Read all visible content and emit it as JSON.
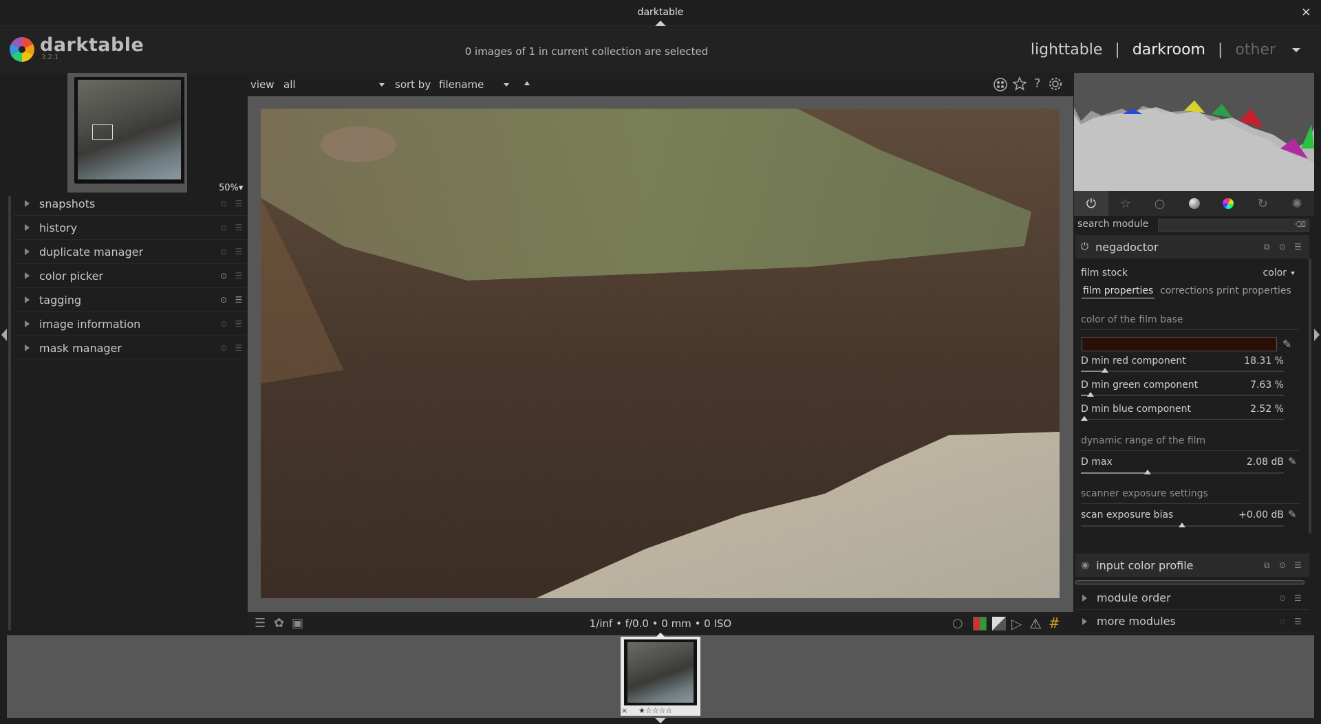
{
  "window": {
    "title": "darktable",
    "close": "×"
  },
  "header": {
    "app_name": "darktable",
    "version": "3.2.1",
    "selection_text": "0 images of 1 in current collection are selected",
    "views": {
      "lighttable": "lighttable",
      "darkroom": "darkroom",
      "other": "other",
      "sep": "|"
    }
  },
  "left": {
    "zoom": "50%▾",
    "modules": [
      {
        "label": "snapshots"
      },
      {
        "label": "history"
      },
      {
        "label": "duplicate manager"
      },
      {
        "label": "color picker"
      },
      {
        "label": "tagging"
      },
      {
        "label": "image information"
      },
      {
        "label": "mask manager"
      }
    ]
  },
  "topbar": {
    "view_label": "view",
    "view_value": "all",
    "sort_label": "sort by",
    "sort_value": "filename"
  },
  "bottombar": {
    "exif": "1/inf • f/0.0 • 0 mm • 0 ISO"
  },
  "right": {
    "search_label": "search module",
    "module": {
      "name": "negadoctor",
      "film_stock_label": "film stock",
      "film_stock_value": "color",
      "tabs": [
        "film properties",
        "corrections",
        "print properties"
      ],
      "section_film_base": "color of the film base",
      "film_base_color": "#2a0f08",
      "sliders": [
        {
          "label": "D min red component",
          "value": "18.31 %",
          "fraction": 0.12
        },
        {
          "label": "D min green component",
          "value": "7.63 %",
          "fraction": 0.05
        },
        {
          "label": "D min blue component",
          "value": "2.52 %",
          "fraction": 0.02
        }
      ],
      "section_dynamic": "dynamic range of the film",
      "dmax": {
        "label": "D max",
        "value": "2.08 dB",
        "fraction": 0.33
      },
      "section_scanner": "scanner exposure settings",
      "bias": {
        "label": "scan exposure bias",
        "value": "+0.00 dB",
        "fraction": 0.5
      }
    },
    "other_modules": [
      {
        "label": "input color profile"
      },
      {
        "label": "module order"
      },
      {
        "label": "more modules"
      }
    ]
  },
  "filmstrip": {
    "thumb_close": "×",
    "thumb_stars": "★☆☆☆☆"
  },
  "colors": {
    "accent": "#cfcfcf",
    "panel": "#1e1e1e",
    "center": "#575757"
  }
}
